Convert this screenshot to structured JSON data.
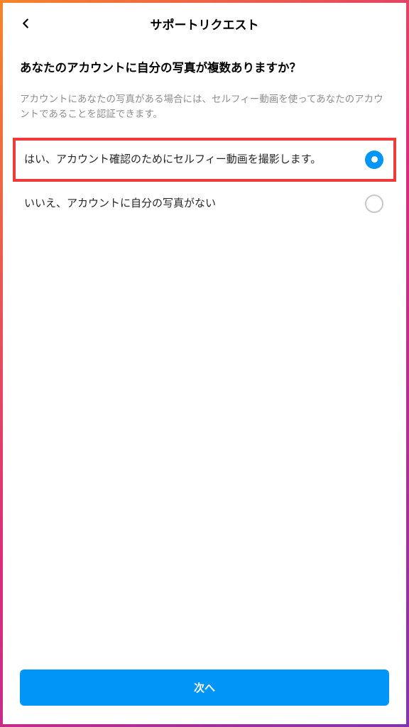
{
  "header": {
    "title": "サポートリクエスト"
  },
  "question": {
    "title": "あなたのアカウントに自分の写真が複数ありますか？",
    "description": "アカウントにあなたの写真がある場合には、セルフィー動画を使ってあなたのアカウントであることを認証できます。"
  },
  "options": [
    {
      "label": "はい、アカウント確認のためにセルフィー動画を撮影します。",
      "selected": true,
      "highlighted": true
    },
    {
      "label": "いいえ、アカウントに自分の写真がない",
      "selected": false,
      "highlighted": false
    }
  ],
  "footer": {
    "next_label": "次へ"
  }
}
